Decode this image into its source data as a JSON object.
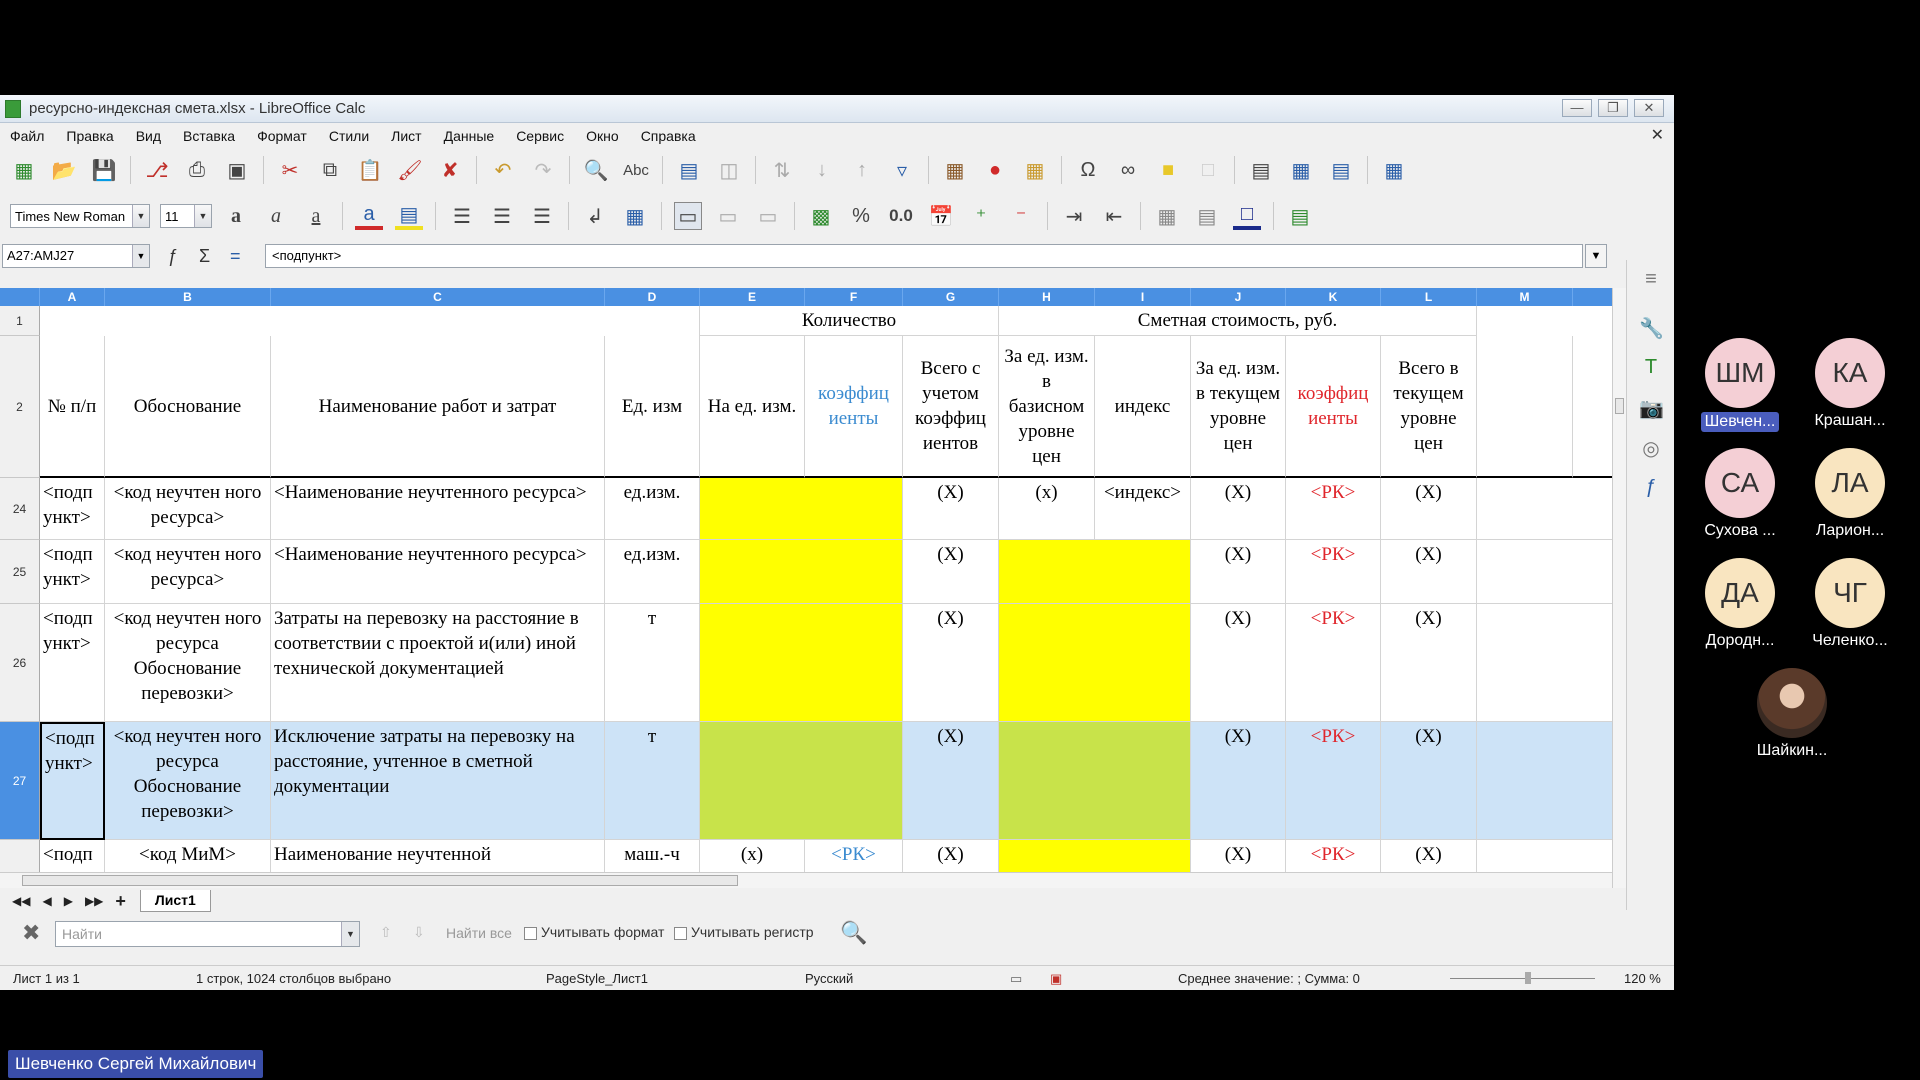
{
  "window": {
    "title": "ресурсно-индексная смета.xlsx - LibreOffice Calc"
  },
  "menu": [
    "Файл",
    "Правка",
    "Вид",
    "Вставка",
    "Формат",
    "Стили",
    "Лист",
    "Данные",
    "Сервис",
    "Окно",
    "Справка"
  ],
  "format_toolbar": {
    "font_name": "Times New Roman",
    "font_size": "11",
    "percent_label": "%",
    "decimal_label": "0.0"
  },
  "formula_bar": {
    "cell_ref": "A27:AMJ27",
    "content": "<подпункт>"
  },
  "columns": [
    "A",
    "B",
    "C",
    "D",
    "E",
    "F",
    "G",
    "H",
    "I",
    "J",
    "K",
    "L",
    "M"
  ],
  "rows": {
    "r1": {
      "num": "1",
      "qty_header": "Количество",
      "cost_header": "Сметная стоимость, руб."
    },
    "r2": {
      "num": "2",
      "a": "№ п/п",
      "b": "Обоснование",
      "c": "Наименование работ и затрат",
      "d": "Ед. изм",
      "e": "На ед. изм.",
      "f": "коэффиц иенты",
      "g": "Всего с учетом коэффиц иентов",
      "h": "За ед. изм. в базисном уровне цен",
      "i": "индекс",
      "j": "За ед. изм. в текущем уровне цен",
      "k": "коэффиц иенты",
      "l": "Всего в текущем уровне цен"
    },
    "r24": {
      "num": "24",
      "a": "<подп ункт>",
      "b": "<код неучтен ного ресурса>",
      "c": "<Наименование неучтенного ресурса>",
      "d": "ед.изм.",
      "g": "(X)",
      "h": "(x)",
      "i": "<индекс>",
      "j": "(X)",
      "k": "<РК>",
      "l": "(X)"
    },
    "r25": {
      "num": "25",
      "a": "<подп ункт>",
      "b": "<код неучтен ного ресурса>",
      "c": "<Наименование неучтенного ресурса>",
      "d": "ед.изм.",
      "g": "(X)",
      "j": "(X)",
      "k": "<РК>",
      "l": "(X)"
    },
    "r26": {
      "num": "26",
      "a": "<подп ункт>",
      "b": "<код неучтен ного ресурса Обоснование перевозки>",
      "c": "Затраты на перевозку на расстояние в соответствии с проектой и(или) иной технической документацией",
      "d": "т",
      "g": "(X)",
      "j": "(X)",
      "k": "<РК>",
      "l": "(X)"
    },
    "r27": {
      "num": "27",
      "a": "<подп ункт>",
      "b": "<код неучтен ного ресурса Обоснование перевозки>",
      "c": "Исключение затраты на перевозку на расстояние, учтенное в сметной документации",
      "d": "т",
      "g": "(X)",
      "j": "(X)",
      "k": "<РК>",
      "l": "(X)"
    },
    "r28": {
      "a": "<подп",
      "b": "<код МиМ>",
      "c": "Наименование неучтенной",
      "d": "маш.-ч",
      "e": "(x)",
      "f": "<РК>",
      "g": "(X)",
      "j": "(X)",
      "k": "<РК>",
      "l": "(X)"
    }
  },
  "sheet_tab": "Лист1",
  "find_bar": {
    "placeholder": "Найти",
    "find_all": "Найти все",
    "match_format": "Учитывать формат",
    "match_case": "Учитывать регистр"
  },
  "status": {
    "sheet": "Лист 1 из 1",
    "selection": "1 строк, 1024 столбцов выбрано",
    "page_style": "PageStyle_Лист1",
    "language": "Русский",
    "summary": "Среднее значение: ; Сумма: 0",
    "zoom": "120 %"
  },
  "participants": [
    {
      "initials": "ШМ",
      "name": "Шевчен...",
      "color": "#f4cfd5"
    },
    {
      "initials": "КА",
      "name": "Крашан...",
      "color": "#f4cfd5"
    },
    {
      "initials": "СА",
      "name": "Сухова ...",
      "color": "#f4cfd5"
    },
    {
      "initials": "ЛА",
      "name": "Ларион...",
      "color": "#f9e5c0"
    },
    {
      "initials": "ДА",
      "name": "Дородн...",
      "color": "#f9e5c0"
    },
    {
      "initials": "ЧГ",
      "name": "Челенко...",
      "color": "#f9e5c0"
    },
    {
      "initials": "",
      "name": "Шайкин...",
      "color": "#8a6a5a"
    }
  ],
  "presenter": "Шевченко Сергей Михайлович"
}
